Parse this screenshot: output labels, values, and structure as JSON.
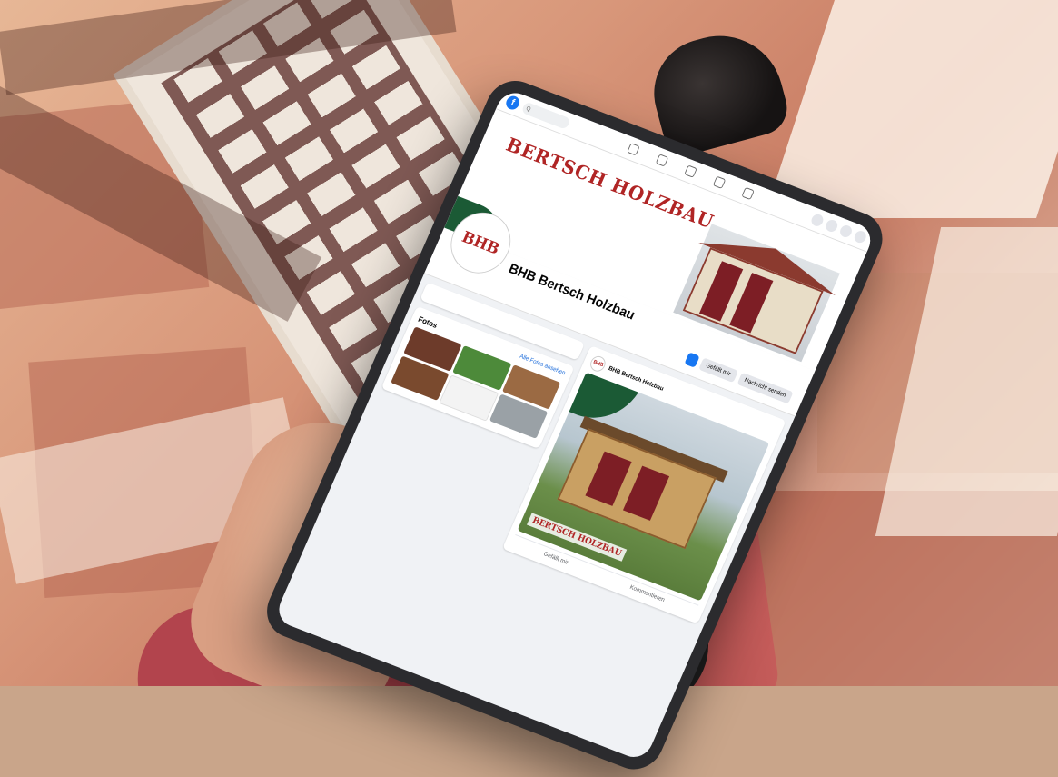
{
  "facebook": {
    "logo_letter": "f",
    "search_placeholder": "Q"
  },
  "cover": {
    "brand": "BERTSCH HOLZBAU",
    "brand_sub": ""
  },
  "profile": {
    "avatar_text": "BHB",
    "name": "BHB Bertsch Holzbau",
    "meta": "",
    "buttons": {
      "primary": "",
      "like": "Gefällt mir",
      "message": "Nachricht senden"
    }
  },
  "intro": {
    "title": "",
    "description": "",
    "lines": []
  },
  "photos": {
    "title": "Fotos",
    "link": "Alle Fotos ansehen"
  },
  "post": {
    "author": "BHB Bertsch Holzbau",
    "time": "",
    "text": "",
    "overlay_logo": "BERTSCH HOLZBAU",
    "actions": {
      "like": "Gefällt mir",
      "comment": "Kommentieren"
    }
  },
  "colors": {
    "facebook_blue": "#1877f2",
    "brand_red": "#b02525",
    "brand_green": "#1b5a35"
  }
}
